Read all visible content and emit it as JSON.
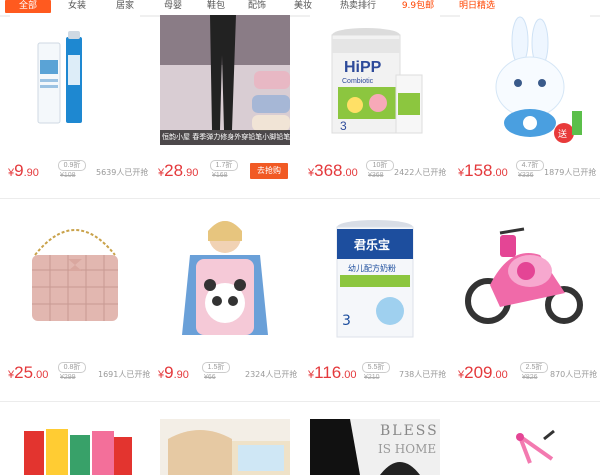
{
  "tabs": [
    {
      "label": "全部",
      "active": true
    },
    {
      "label": "女装"
    },
    {
      "label": "居家"
    },
    {
      "label": "母婴"
    },
    {
      "label": "鞋包"
    },
    {
      "label": "配饰"
    },
    {
      "label": "美妆"
    },
    {
      "label": "热卖排行"
    },
    {
      "label": "9.9包邮",
      "hot": true
    },
    {
      "label": "明日精选",
      "hot": true
    }
  ],
  "colors": {
    "accent": "#ff5a1f",
    "price": "#e4393c",
    "buy_button": "#f15a24"
  },
  "products": [
    {
      "image": "skincare-cream-bottle-image",
      "yen": "¥",
      "price_int": "9",
      "price_dec": ".90",
      "discount": "0.9折",
      "orig": "¥108",
      "sold": "5639人已开抢"
    },
    {
      "image": "leggings-model-image",
      "caption": "恒韵小屋 春季弹力修身外穿铅笔小脚铅笔",
      "yen": "¥",
      "price_int": "28",
      "price_dec": ".90",
      "discount": "1.7折",
      "orig": "¥168",
      "buy": "去抢购"
    },
    {
      "image": "hipp-formula-can-image",
      "can_brand": "HiPP",
      "can_sub": "Combiotic",
      "yen": "¥",
      "price_int": "368",
      "price_dec": ".00",
      "discount": "10折",
      "orig": "¥368",
      "sold": "2422人已开抢"
    },
    {
      "image": "bunny-night-light-toy-image",
      "badge": "送",
      "yen": "¥",
      "price_int": "158",
      "price_dec": ".00",
      "discount": "4.7折",
      "orig": "¥336",
      "sold": "1879人已开抢"
    },
    {
      "image": "pink-quilted-crossbody-bag-image",
      "yen": "¥",
      "price_int": "25",
      "price_dec": ".00",
      "discount": "0.8折",
      "orig": "¥299",
      "sold": "1691人已开抢"
    },
    {
      "image": "child-smock-panda-image",
      "yen": "¥",
      "price_int": "9",
      "price_dec": ".90",
      "discount": "1.5折",
      "orig": "¥66",
      "sold": "2324人已开抢"
    },
    {
      "image": "junlebao-formula-can-image",
      "can_brand": "君乐宝",
      "can_sub": "幼儿配方奶粉",
      "yen": "¥",
      "price_int": "116",
      "price_dec": ".00",
      "discount": "5.5折",
      "orig": "¥210",
      "sold": "738人已开抢"
    },
    {
      "image": "pink-kids-motorbike-image",
      "yen": "¥",
      "price_int": "209",
      "price_dec": ".00",
      "discount": "2.5折",
      "orig": "¥826",
      "sold": "870人已开抢"
    },
    {
      "image": "snack-boxes-image"
    },
    {
      "image": "wooden-crib-image"
    },
    {
      "image": "black-backpack-image",
      "overlay_text_1": "BLESS",
      "overlay_text_2": "IS HOME"
    },
    {
      "image": "pink-kids-bicycle-image"
    }
  ]
}
